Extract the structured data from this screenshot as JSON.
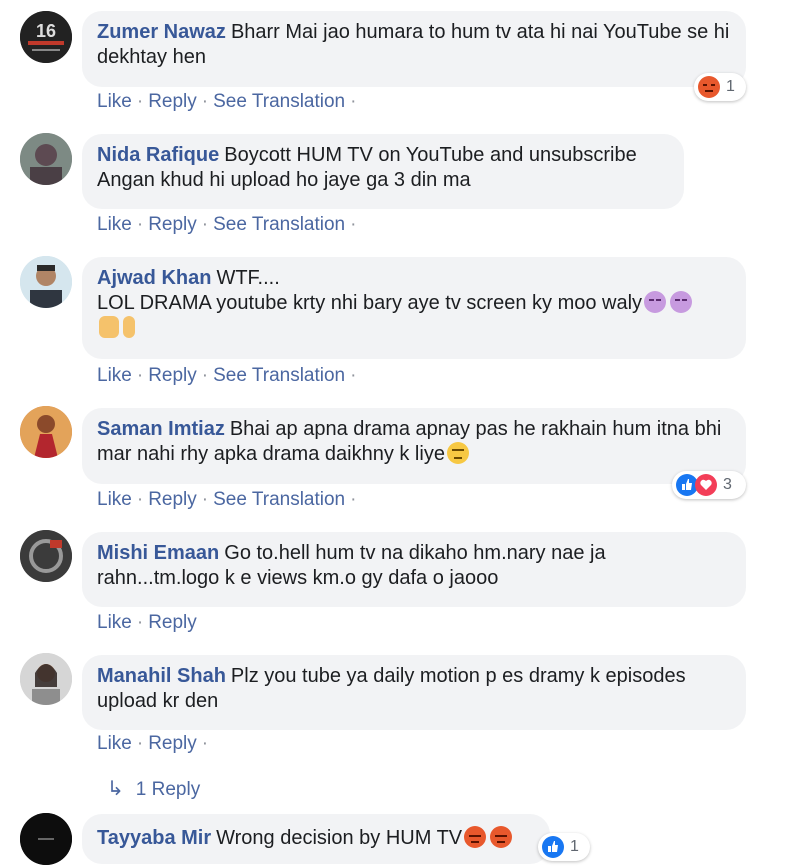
{
  "actions": {
    "like": "Like",
    "reply": "Reply",
    "see_translation": "See Translation",
    "sep": "·"
  },
  "comments": [
    {
      "author": "Zumer Nawaz",
      "text": "Bharr Mai jao humara to hum tv ata hi nai YouTube se hi dekhtay hen",
      "reaction_count": "1",
      "reaction_icons": [
        "angry-icon"
      ],
      "avatar_caption": "16"
    },
    {
      "author": "Nida Rafique",
      "text": "Boycott HUM TV on YouTube and unsubscribe Angan khud hi upload ho jaye ga 3 din ma"
    },
    {
      "author": "Ajwad Khan",
      "line1": "WTF....",
      "line2": "LOL DRAMA youtube krty nhi bary aye tv screen ky moo waly"
    },
    {
      "author": "Saman Imtiaz",
      "text": "Bhai ap apna drama apnay pas he rakhain hum itna bhi mar nahi rhy apka drama daikhny k liye",
      "reaction_count": "3",
      "reaction_icons": [
        "like-icon",
        "love-icon"
      ]
    },
    {
      "author": "Mishi Emaan",
      "text": "Go to.hell hum tv na dikaho hm.nary nae ja rahn...tm.logo k e views km.o gy dafa o jaooo"
    },
    {
      "author": "Manahil Shah",
      "text": "Plz you tube ya daily motion p es dramy k episodes upload kr den"
    },
    {
      "author": "Tayyaba Mir",
      "text": "Wrong decision by HUM TV",
      "reaction_count": "1",
      "reaction_icons": [
        "like-icon"
      ]
    }
  ],
  "reply_link": {
    "label": "1 Reply",
    "icon": "reply-arrow-icon"
  },
  "colors": {
    "author": "#385898",
    "link": "#4b67a1",
    "bubble": "#f2f3f5",
    "like": "#1877f2",
    "love": "#f33e58",
    "angry": "#e8582c"
  }
}
